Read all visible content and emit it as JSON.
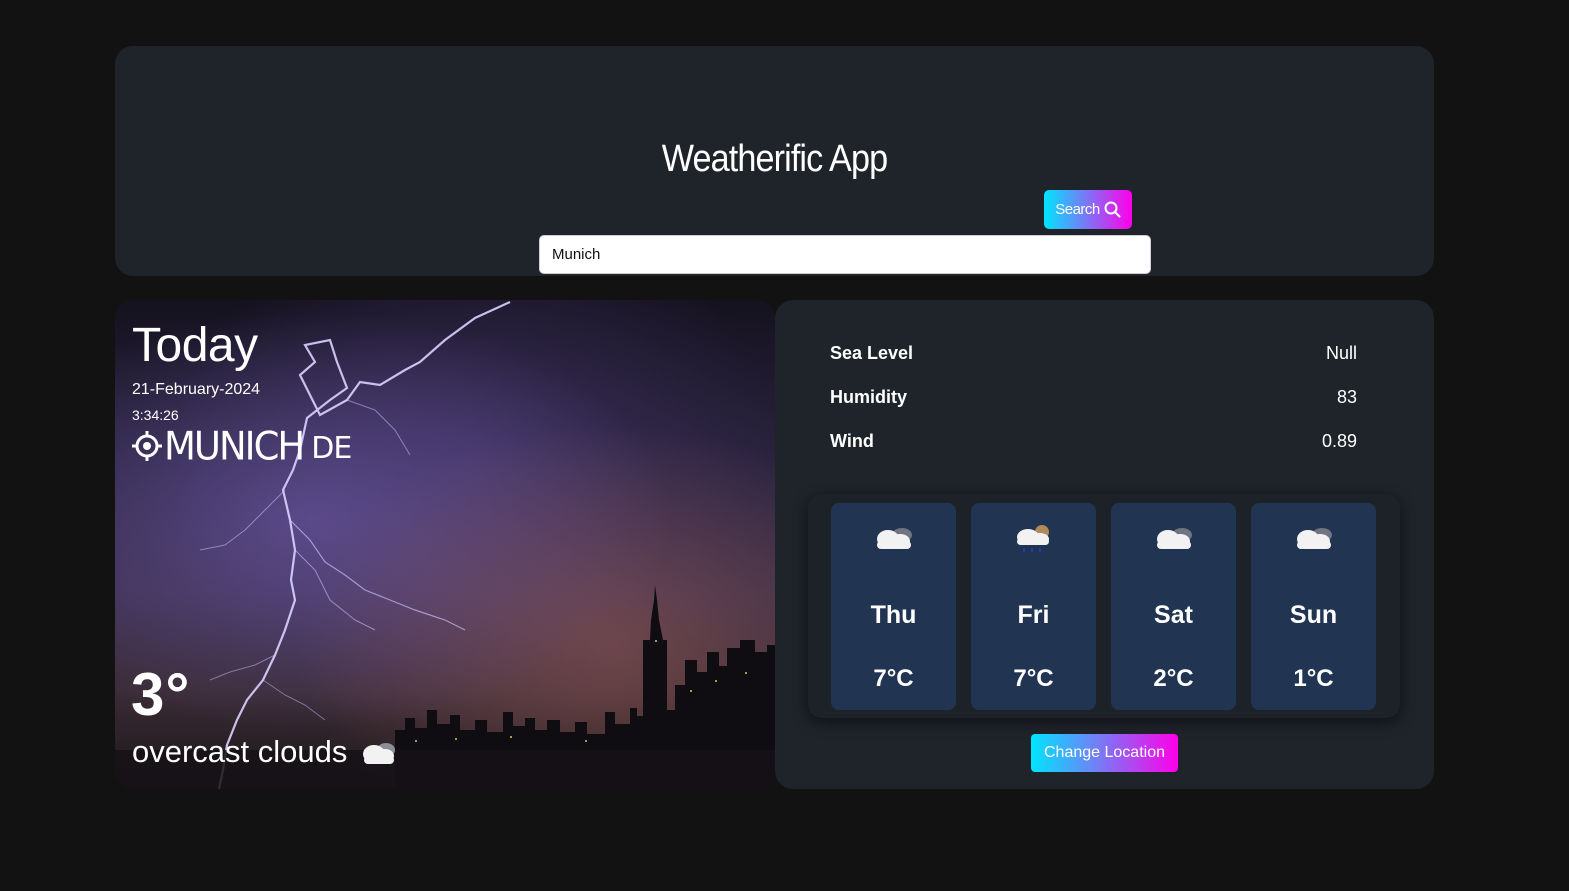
{
  "app": {
    "title": "Weatherific App"
  },
  "search": {
    "value": "Munich",
    "button_label": "Search",
    "button_icon": "search-icon"
  },
  "today": {
    "label": "Today",
    "date": "21-February-2024",
    "time": "3:34:26",
    "location_icon": "location-target-icon",
    "city": "MUNICH",
    "country": "DE",
    "temperature": "3°",
    "condition": "overcast clouds",
    "condition_icon": "cloud-icon"
  },
  "details": [
    {
      "label": "Sea Level",
      "value": "Null"
    },
    {
      "label": "Humidity",
      "value": "83"
    },
    {
      "label": "Wind",
      "value": "0.89"
    }
  ],
  "forecast": [
    {
      "day": "Thu",
      "temp": "7°C",
      "icon": "cloud-icon"
    },
    {
      "day": "Fri",
      "temp": "7°C",
      "icon": "rain-cloud-icon"
    },
    {
      "day": "Sat",
      "temp": "2°C",
      "icon": "cloud-icon"
    },
    {
      "day": "Sun",
      "temp": "1°C",
      "icon": "cloud-icon"
    }
  ],
  "change_location": {
    "label": "Change Location"
  },
  "colors": {
    "page_bg": "#121212",
    "card_bg": "#1f232a",
    "forecast_card_bg": "#213452",
    "gradient_start": "#00e5ff",
    "gradient_end": "#ff00ea"
  }
}
